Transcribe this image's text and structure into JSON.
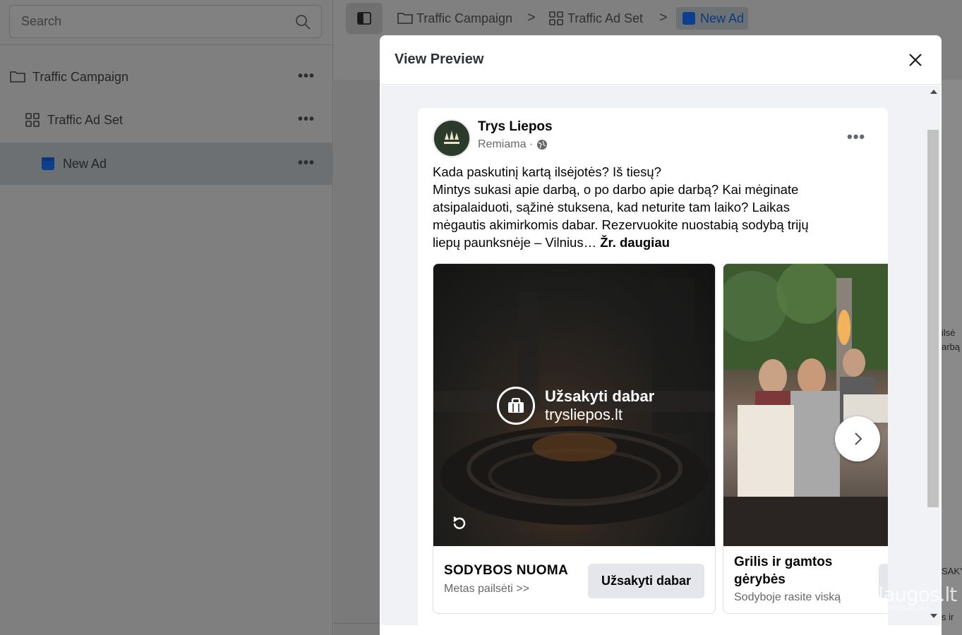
{
  "sidebar": {
    "search": {
      "placeholder": "Search"
    },
    "items": [
      {
        "label": "Traffic Campaign",
        "icon": "folder-icon",
        "more": "•••"
      },
      {
        "label": "Traffic Ad Set",
        "icon": "grid-icon",
        "more": "•••"
      },
      {
        "label": "New Ad",
        "icon": "ad-square-icon",
        "more": "•••"
      }
    ]
  },
  "breadcrumb": {
    "items": [
      {
        "label": "Traffic Campaign",
        "icon": "folder-icon"
      },
      {
        "label": "Traffic Ad Set",
        "icon": "grid-icon"
      },
      {
        "label": "New Ad",
        "icon": "ad-square-icon"
      }
    ],
    "separator": ">"
  },
  "background_text": {
    "line1": "ilsė",
    "line2": "arbą",
    "line3": "SAKY",
    "line4": "s ir"
  },
  "modal": {
    "title": "View Preview",
    "close_icon": "close-icon"
  },
  "post": {
    "page_name": "Trys Liepos",
    "sponsored": "Remiama ·",
    "more": "•••",
    "text_lines": [
      "Kada paskutinį kartą ilsėjotės? Iš tiesų?",
      "Mintys sukasi apie darbą, o po darbo apie darbą? Kai mėginate",
      "atsipalaiduoti, sąžinė stuksena, kad neturite tam laiko? Laikas",
      "mėgautis akimirkomis dabar. Rezervuokite nuostabią sodybą trijų",
      "liepų paunksnėje – Vilnius…"
    ],
    "see_more": "Žr. daugiau",
    "carousel": [
      {
        "overlay_title": "Užsakyti dabar",
        "overlay_sub": "trysliepos.lt",
        "title": "SODYBOS NUOMA",
        "description": "Metas pailsėti >>",
        "cta": "Užsakyti dabar"
      },
      {
        "title": "Grilis ir gamtos gėrybės",
        "description": "Sodyboje rasite viską"
      }
    ]
  },
  "watermark": {
    "main": "Paslaugos.lt",
    "sub": "PASLAUGŲ PORTALAS   Nr.1"
  },
  "colors": {
    "modal_bg": "#ffffff",
    "feed_bg": "#f0f2f5",
    "active_blue": "#1877f2",
    "overlay_dim": "#808080"
  }
}
